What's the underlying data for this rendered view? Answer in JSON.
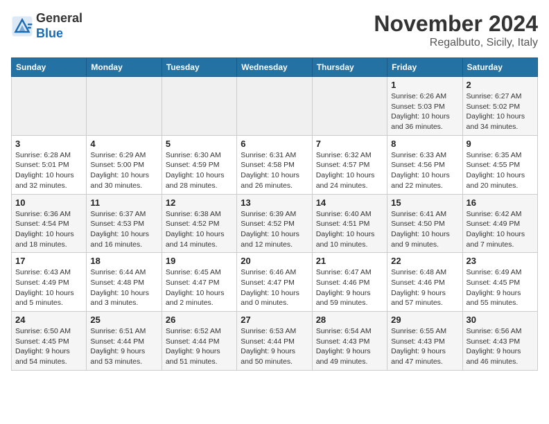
{
  "header": {
    "logo_line1": "General",
    "logo_line2": "Blue",
    "month": "November 2024",
    "location": "Regalbuto, Sicily, Italy"
  },
  "weekdays": [
    "Sunday",
    "Monday",
    "Tuesday",
    "Wednesday",
    "Thursday",
    "Friday",
    "Saturday"
  ],
  "weeks": [
    [
      {
        "day": "",
        "info": ""
      },
      {
        "day": "",
        "info": ""
      },
      {
        "day": "",
        "info": ""
      },
      {
        "day": "",
        "info": ""
      },
      {
        "day": "",
        "info": ""
      },
      {
        "day": "1",
        "info": "Sunrise: 6:26 AM\nSunset: 5:03 PM\nDaylight: 10 hours\nand 36 minutes."
      },
      {
        "day": "2",
        "info": "Sunrise: 6:27 AM\nSunset: 5:02 PM\nDaylight: 10 hours\nand 34 minutes."
      }
    ],
    [
      {
        "day": "3",
        "info": "Sunrise: 6:28 AM\nSunset: 5:01 PM\nDaylight: 10 hours\nand 32 minutes."
      },
      {
        "day": "4",
        "info": "Sunrise: 6:29 AM\nSunset: 5:00 PM\nDaylight: 10 hours\nand 30 minutes."
      },
      {
        "day": "5",
        "info": "Sunrise: 6:30 AM\nSunset: 4:59 PM\nDaylight: 10 hours\nand 28 minutes."
      },
      {
        "day": "6",
        "info": "Sunrise: 6:31 AM\nSunset: 4:58 PM\nDaylight: 10 hours\nand 26 minutes."
      },
      {
        "day": "7",
        "info": "Sunrise: 6:32 AM\nSunset: 4:57 PM\nDaylight: 10 hours\nand 24 minutes."
      },
      {
        "day": "8",
        "info": "Sunrise: 6:33 AM\nSunset: 4:56 PM\nDaylight: 10 hours\nand 22 minutes."
      },
      {
        "day": "9",
        "info": "Sunrise: 6:35 AM\nSunset: 4:55 PM\nDaylight: 10 hours\nand 20 minutes."
      }
    ],
    [
      {
        "day": "10",
        "info": "Sunrise: 6:36 AM\nSunset: 4:54 PM\nDaylight: 10 hours\nand 18 minutes."
      },
      {
        "day": "11",
        "info": "Sunrise: 6:37 AM\nSunset: 4:53 PM\nDaylight: 10 hours\nand 16 minutes."
      },
      {
        "day": "12",
        "info": "Sunrise: 6:38 AM\nSunset: 4:52 PM\nDaylight: 10 hours\nand 14 minutes."
      },
      {
        "day": "13",
        "info": "Sunrise: 6:39 AM\nSunset: 4:52 PM\nDaylight: 10 hours\nand 12 minutes."
      },
      {
        "day": "14",
        "info": "Sunrise: 6:40 AM\nSunset: 4:51 PM\nDaylight: 10 hours\nand 10 minutes."
      },
      {
        "day": "15",
        "info": "Sunrise: 6:41 AM\nSunset: 4:50 PM\nDaylight: 10 hours\nand 9 minutes."
      },
      {
        "day": "16",
        "info": "Sunrise: 6:42 AM\nSunset: 4:49 PM\nDaylight: 10 hours\nand 7 minutes."
      }
    ],
    [
      {
        "day": "17",
        "info": "Sunrise: 6:43 AM\nSunset: 4:49 PM\nDaylight: 10 hours\nand 5 minutes."
      },
      {
        "day": "18",
        "info": "Sunrise: 6:44 AM\nSunset: 4:48 PM\nDaylight: 10 hours\nand 3 minutes."
      },
      {
        "day": "19",
        "info": "Sunrise: 6:45 AM\nSunset: 4:47 PM\nDaylight: 10 hours\nand 2 minutes."
      },
      {
        "day": "20",
        "info": "Sunrise: 6:46 AM\nSunset: 4:47 PM\nDaylight: 10 hours\nand 0 minutes."
      },
      {
        "day": "21",
        "info": "Sunrise: 6:47 AM\nSunset: 4:46 PM\nDaylight: 9 hours\nand 59 minutes."
      },
      {
        "day": "22",
        "info": "Sunrise: 6:48 AM\nSunset: 4:46 PM\nDaylight: 9 hours\nand 57 minutes."
      },
      {
        "day": "23",
        "info": "Sunrise: 6:49 AM\nSunset: 4:45 PM\nDaylight: 9 hours\nand 55 minutes."
      }
    ],
    [
      {
        "day": "24",
        "info": "Sunrise: 6:50 AM\nSunset: 4:45 PM\nDaylight: 9 hours\nand 54 minutes."
      },
      {
        "day": "25",
        "info": "Sunrise: 6:51 AM\nSunset: 4:44 PM\nDaylight: 9 hours\nand 53 minutes."
      },
      {
        "day": "26",
        "info": "Sunrise: 6:52 AM\nSunset: 4:44 PM\nDaylight: 9 hours\nand 51 minutes."
      },
      {
        "day": "27",
        "info": "Sunrise: 6:53 AM\nSunset: 4:44 PM\nDaylight: 9 hours\nand 50 minutes."
      },
      {
        "day": "28",
        "info": "Sunrise: 6:54 AM\nSunset: 4:43 PM\nDaylight: 9 hours\nand 49 minutes."
      },
      {
        "day": "29",
        "info": "Sunrise: 6:55 AM\nSunset: 4:43 PM\nDaylight: 9 hours\nand 47 minutes."
      },
      {
        "day": "30",
        "info": "Sunrise: 6:56 AM\nSunset: 4:43 PM\nDaylight: 9 hours\nand 46 minutes."
      }
    ]
  ]
}
